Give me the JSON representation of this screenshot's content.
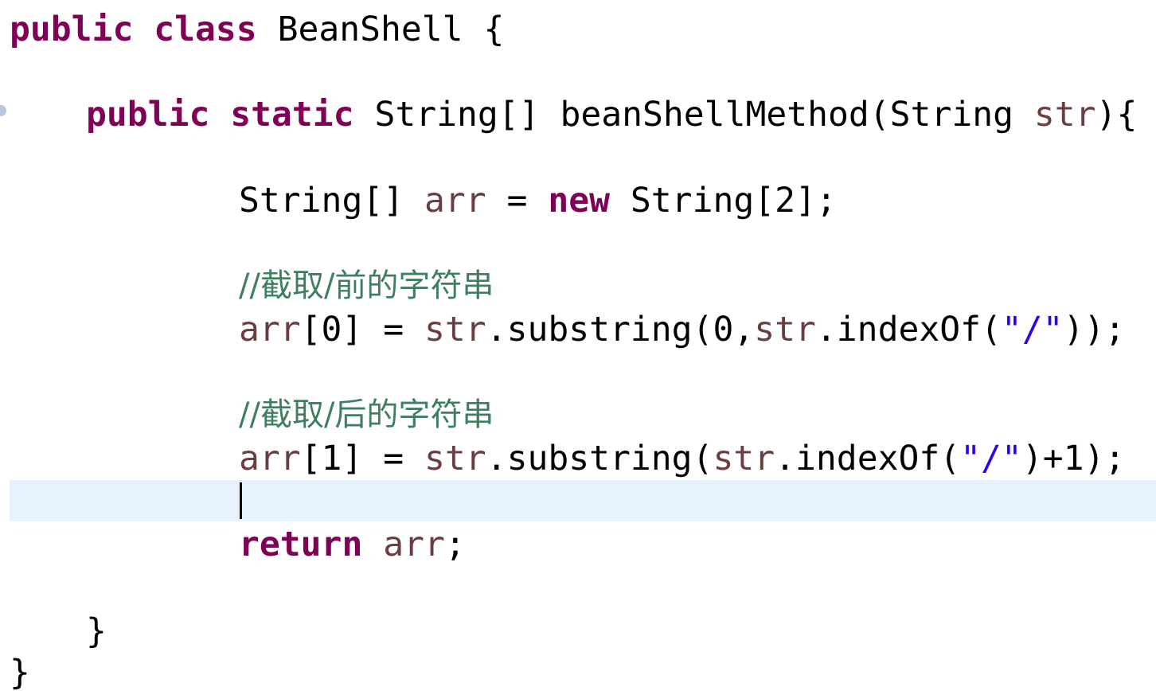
{
  "editor": {
    "colors": {
      "keyword": "#7f0055",
      "local_variable": "#6a3e3e",
      "string": "#2a00ff",
      "comment": "#3f7f5f",
      "current_line": "#e8f2fe"
    },
    "lines": [
      {
        "kw1": "public",
        "kw2": "class",
        "rest": "BeanShell {"
      },
      {
        "kw1": "public",
        "kw2": "static",
        "t1": "String[] beanShellMethod(String ",
        "v1": "str",
        "t2": "){"
      },
      {
        "t1": "String[] ",
        "v1": "arr",
        "t2": " = ",
        "kw1": "new",
        "t3": " String[2];"
      },
      {
        "comment": "//截取/前的字符串"
      },
      {
        "v1": "arr",
        "t1": "[0] = ",
        "v2": "str",
        "t2": ".substring(0,",
        "v3": "str",
        "t3": ".indexOf(",
        "s1": "\"/\"",
        "t4": "));"
      },
      {
        "comment": "//截取/后的字符串"
      },
      {
        "v1": "arr",
        "t1": "[1] = ",
        "v2": "str",
        "t2": ".substring(",
        "v3": "str",
        "t3": ".indexOf(",
        "s1": "\"/\"",
        "t4": ")+1);"
      },
      {
        "kw1": "return",
        "v1": "arr",
        "t1": ";"
      },
      {
        "t1": "}"
      },
      {
        "t1": "}"
      }
    ]
  }
}
